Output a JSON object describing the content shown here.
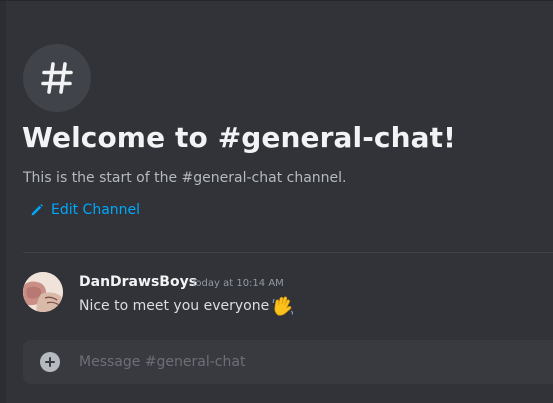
{
  "channel": {
    "icon": "hash-icon",
    "welcome_title": "Welcome to #general-chat!",
    "welcome_subtitle": "This is the start of the #general-chat channel.",
    "edit_label": "Edit Channel",
    "edit_icon": "pencil-icon"
  },
  "message": {
    "username": "DanDrawsBoys",
    "timestamp": "Today at 10:14 AM",
    "text": "Nice to meet you everyone",
    "emoji": "waving-hand-emoji"
  },
  "composer": {
    "placeholder": "Message #general-chat",
    "value": ""
  },
  "colors": {
    "background": "#313338",
    "link": "#00a8fc",
    "composer": "#383a40"
  }
}
